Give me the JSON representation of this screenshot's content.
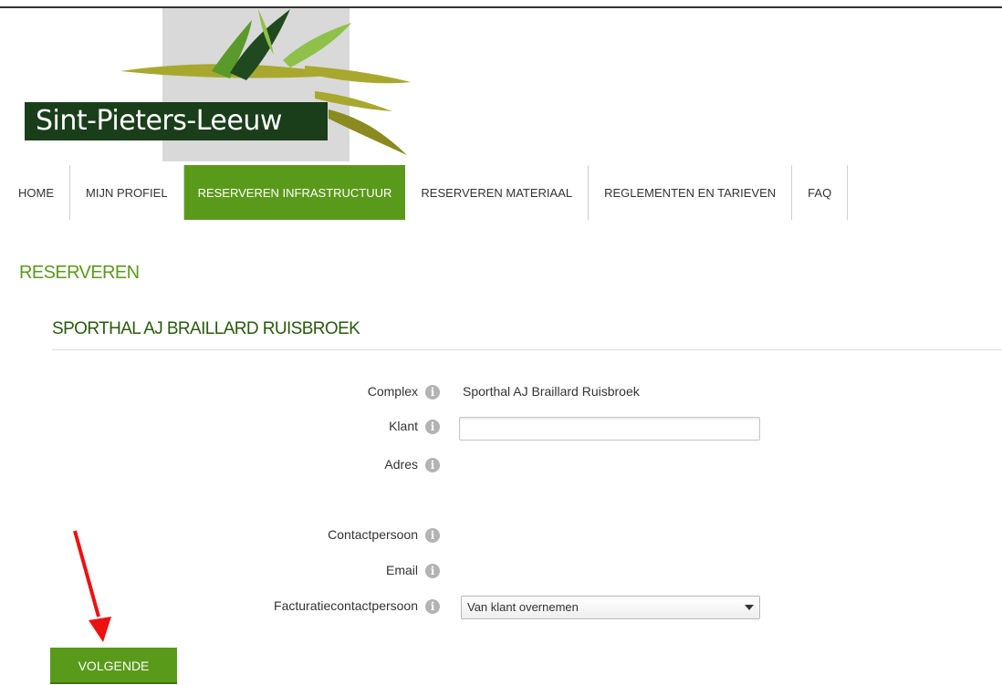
{
  "logo": {
    "text": "Sint-Pieters-Leeuw"
  },
  "nav": {
    "items": [
      {
        "label": "HOME",
        "active": false
      },
      {
        "label": "MIJN PROFIEL",
        "active": false
      },
      {
        "label": "RESERVEREN INFRASTRUCTUUR",
        "active": true
      },
      {
        "label": "RESERVEREN MATERIAAL",
        "active": false
      },
      {
        "label": "REGLEMENTEN EN TARIEVEN",
        "active": false
      },
      {
        "label": "FAQ",
        "active": false
      }
    ]
  },
  "page": {
    "title": "RESERVEREN",
    "subtitle": "SPORTHAL AJ BRAILLARD RUISBROEK"
  },
  "form": {
    "complex_label": "Complex",
    "complex_value": "Sporthal AJ Braillard Ruisbroek",
    "klant_label": "Klant",
    "klant_value": "",
    "adres_label": "Adres",
    "contact_label": "Contactpersoon",
    "email_label": "Email",
    "factuur_label": "Facturatiecontactpersoon",
    "factuur_selected": "Van klant overnemen"
  },
  "actions": {
    "next_label": "VOLGENDE"
  },
  "colors": {
    "accent": "#5a9a1b",
    "dark_green": "#1a3d1a",
    "annotation_arrow": "#ee1111"
  },
  "icons": {
    "info": "info-icon",
    "dropdown": "chevron-down-icon",
    "annotation": "red-arrow-icon"
  }
}
